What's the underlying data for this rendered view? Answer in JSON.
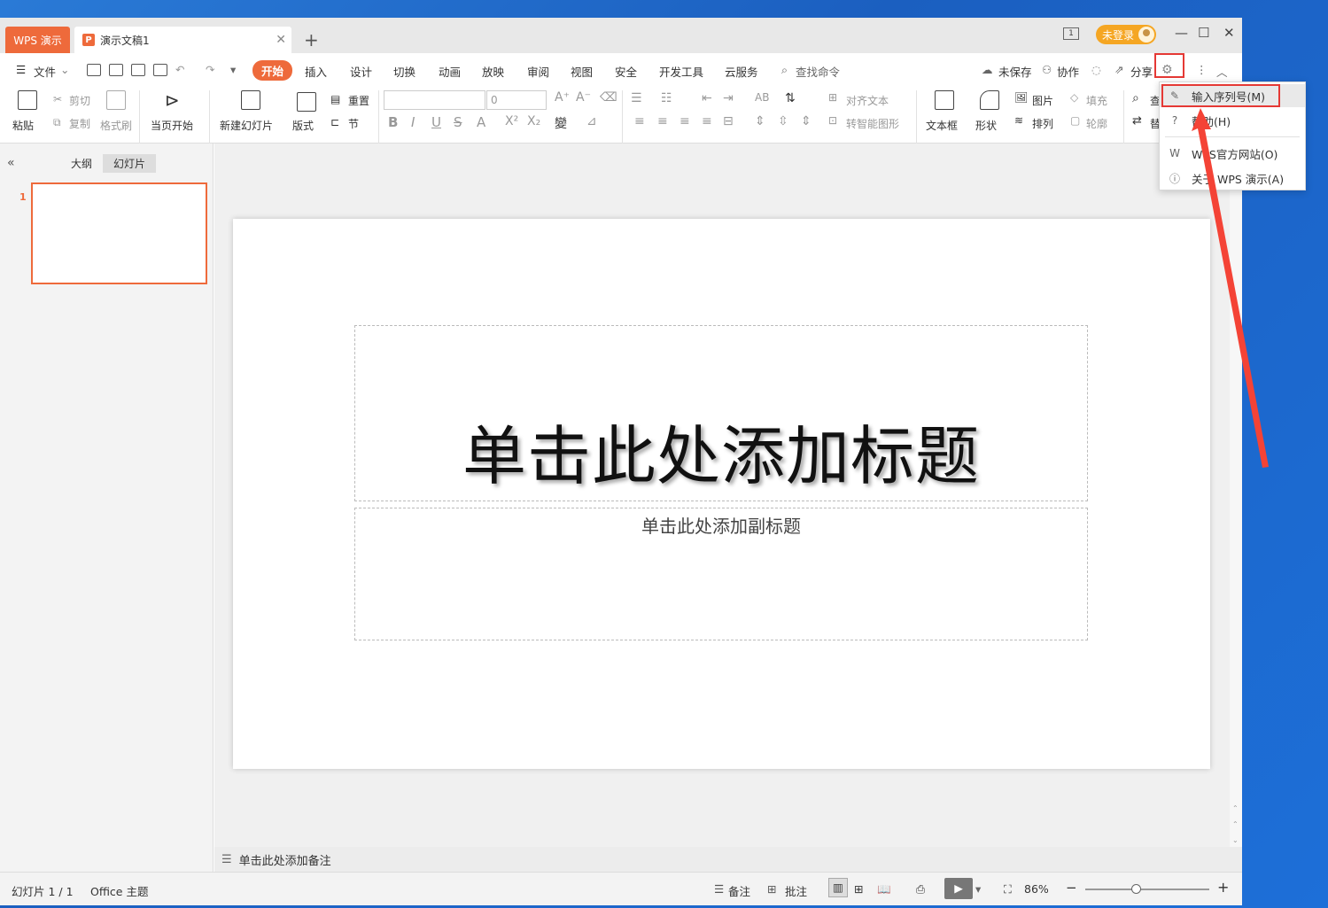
{
  "titlebar": {
    "app_tab": "WPS 演示",
    "doc_tab": "演示文稿1",
    "doc_icon": "P",
    "new_tab": "+",
    "book_icon": "1",
    "login": "未登录",
    "minimize": "—",
    "maximize": "☐",
    "close": "✕"
  },
  "menu": {
    "file": "文件",
    "tabs": [
      "开始",
      "插入",
      "设计",
      "切换",
      "动画",
      "放映",
      "审阅",
      "视图",
      "安全",
      "开发工具",
      "云服务"
    ],
    "search": "查找命令",
    "unsaved": "未保存",
    "collab": "协作",
    "share": "分享"
  },
  "ribbon": {
    "paste": "粘贴",
    "cut": "剪切",
    "copy": "复制",
    "format_painter": "格式刷",
    "play_current": "当页开始",
    "new_slide": "新建幻灯片",
    "layout": "版式",
    "reset": "重置",
    "section": "节",
    "font_size": "0",
    "align_text": "对齐文本",
    "smart_shape": "转智能图形",
    "textbox": "文本框",
    "shapes": "形状",
    "picture": "图片",
    "arrange": "排列",
    "fill": "填充",
    "outline": "轮廓",
    "find_partial": "查",
    "replace_partial": "替"
  },
  "leftpane": {
    "collapse": "«",
    "outline_tab": "大纲",
    "slides_tab": "幻灯片",
    "slide_number": "1"
  },
  "slide": {
    "title_placeholder": "单击此处添加标题",
    "subtitle_placeholder": "单击此处添加副标题"
  },
  "notes": {
    "placeholder": "单击此处添加备注"
  },
  "status": {
    "slide_count": "幻灯片 1 / 1",
    "theme": "Office 主题",
    "notes_btn": "备注",
    "comment_btn": "批注",
    "zoom": "86%"
  },
  "popup": {
    "items": [
      {
        "label": "输入序列号(M)",
        "icon": "✎"
      },
      {
        "label": "帮助(H)",
        "icon": "?"
      },
      {
        "label": "WPS官方网站(O)",
        "icon": "W"
      },
      {
        "label": "关于 WPS 演示(A)",
        "icon": "ⓘ"
      }
    ]
  },
  "colors": {
    "accent": "#ee6a3b",
    "highlight": "#e53935",
    "login": "#f5a623"
  }
}
